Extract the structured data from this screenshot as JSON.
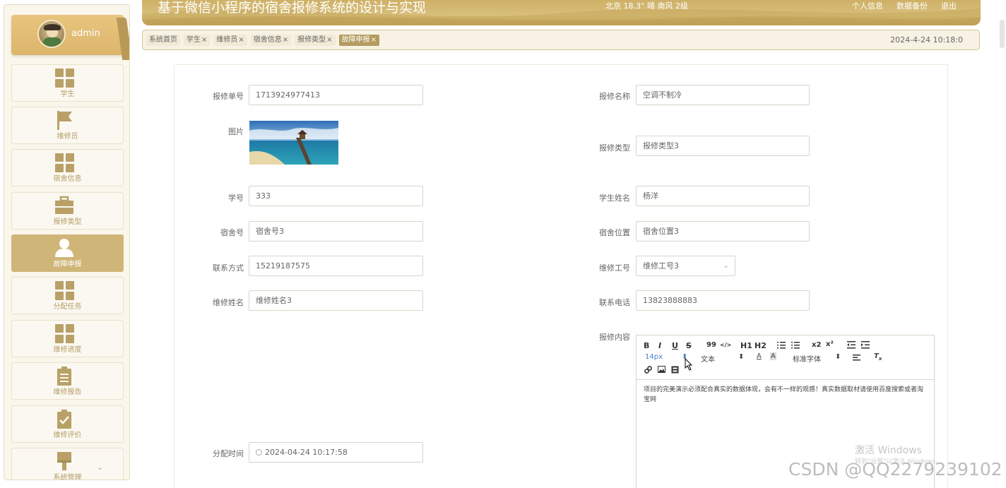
{
  "header": {
    "title": "基于微信小程序的宿舍报修系统的设计与实现",
    "weather": "北京 18.3° 晴 南风 2级",
    "links": [
      "个人信息",
      "数据备份",
      "退出"
    ]
  },
  "user": {
    "name": "admin"
  },
  "sidebar": {
    "items": [
      {
        "label": "学生",
        "icon": "grid-icon"
      },
      {
        "label": "维修员",
        "icon": "flag-icon"
      },
      {
        "label": "宿舍信息",
        "icon": "grid-icon"
      },
      {
        "label": "报修类型",
        "icon": "briefcase-icon"
      },
      {
        "label": "故障申报",
        "icon": "user-icon",
        "active": true
      },
      {
        "label": "分配任务",
        "icon": "grid-icon"
      },
      {
        "label": "维修进度",
        "icon": "grid-icon"
      },
      {
        "label": "维修报告",
        "icon": "clipboard-icon"
      },
      {
        "label": "维修评价",
        "icon": "checklist-icon"
      },
      {
        "label": "系统管理",
        "icon": "brush-icon"
      }
    ]
  },
  "tabs": {
    "items": [
      "系统首页",
      "学生",
      "维修员",
      "宿舍信息",
      "报修类型",
      "故障申报"
    ],
    "active": "故障申报",
    "close": "×",
    "datetime": "2024-4-24 10:18:0"
  },
  "form": {
    "repair_no": {
      "label": "报修单号",
      "value": "1713924977413"
    },
    "repair_name": {
      "label": "报修名称",
      "value": "空调不制冷"
    },
    "image": {
      "label": "图片"
    },
    "repair_type": {
      "label": "报修类型",
      "value": "报修类型3"
    },
    "student_no": {
      "label": "学号",
      "value": "333"
    },
    "student_name": {
      "label": "学生姓名",
      "value": "杨洋"
    },
    "dorm_no": {
      "label": "宿舍号",
      "value": "宿舍号3"
    },
    "dorm_location": {
      "label": "宿舍位置",
      "value": "宿舍位置3"
    },
    "contact": {
      "label": "联系方式",
      "value": "15219187575"
    },
    "worker_no": {
      "label": "维修工号",
      "value": "维修工号3"
    },
    "worker_name": {
      "label": "维修姓名",
      "value": "维修姓名3"
    },
    "phone": {
      "label": "联系电话",
      "value": "13823888883"
    },
    "content": {
      "label": "报修内容",
      "text": "项目的完美演示必须配合真实的数据体现，会有不一样的观感！真实数据取材请使用百度搜索或者淘宝网"
    },
    "assign_time": {
      "label": "分配时间",
      "value": "2024-04-24 10:17:58"
    }
  },
  "editor": {
    "font_size": "14px",
    "paragraph": "文本",
    "font_family": "标准字体",
    "buttons": [
      "B",
      "I",
      "U",
      "S",
      "99",
      "</>",
      "H1",
      "H2",
      "x2",
      "x²"
    ]
  },
  "watermark": {
    "activate": "激活 Windows",
    "activate_hint": "转到\"设置\"以激活 Windows。",
    "csdn": "CSDN @QQ2279239102"
  },
  "colors": {
    "accent": "#cfb678",
    "accent_dark": "#b49b5f",
    "header_gold": "#d8bf7c"
  }
}
